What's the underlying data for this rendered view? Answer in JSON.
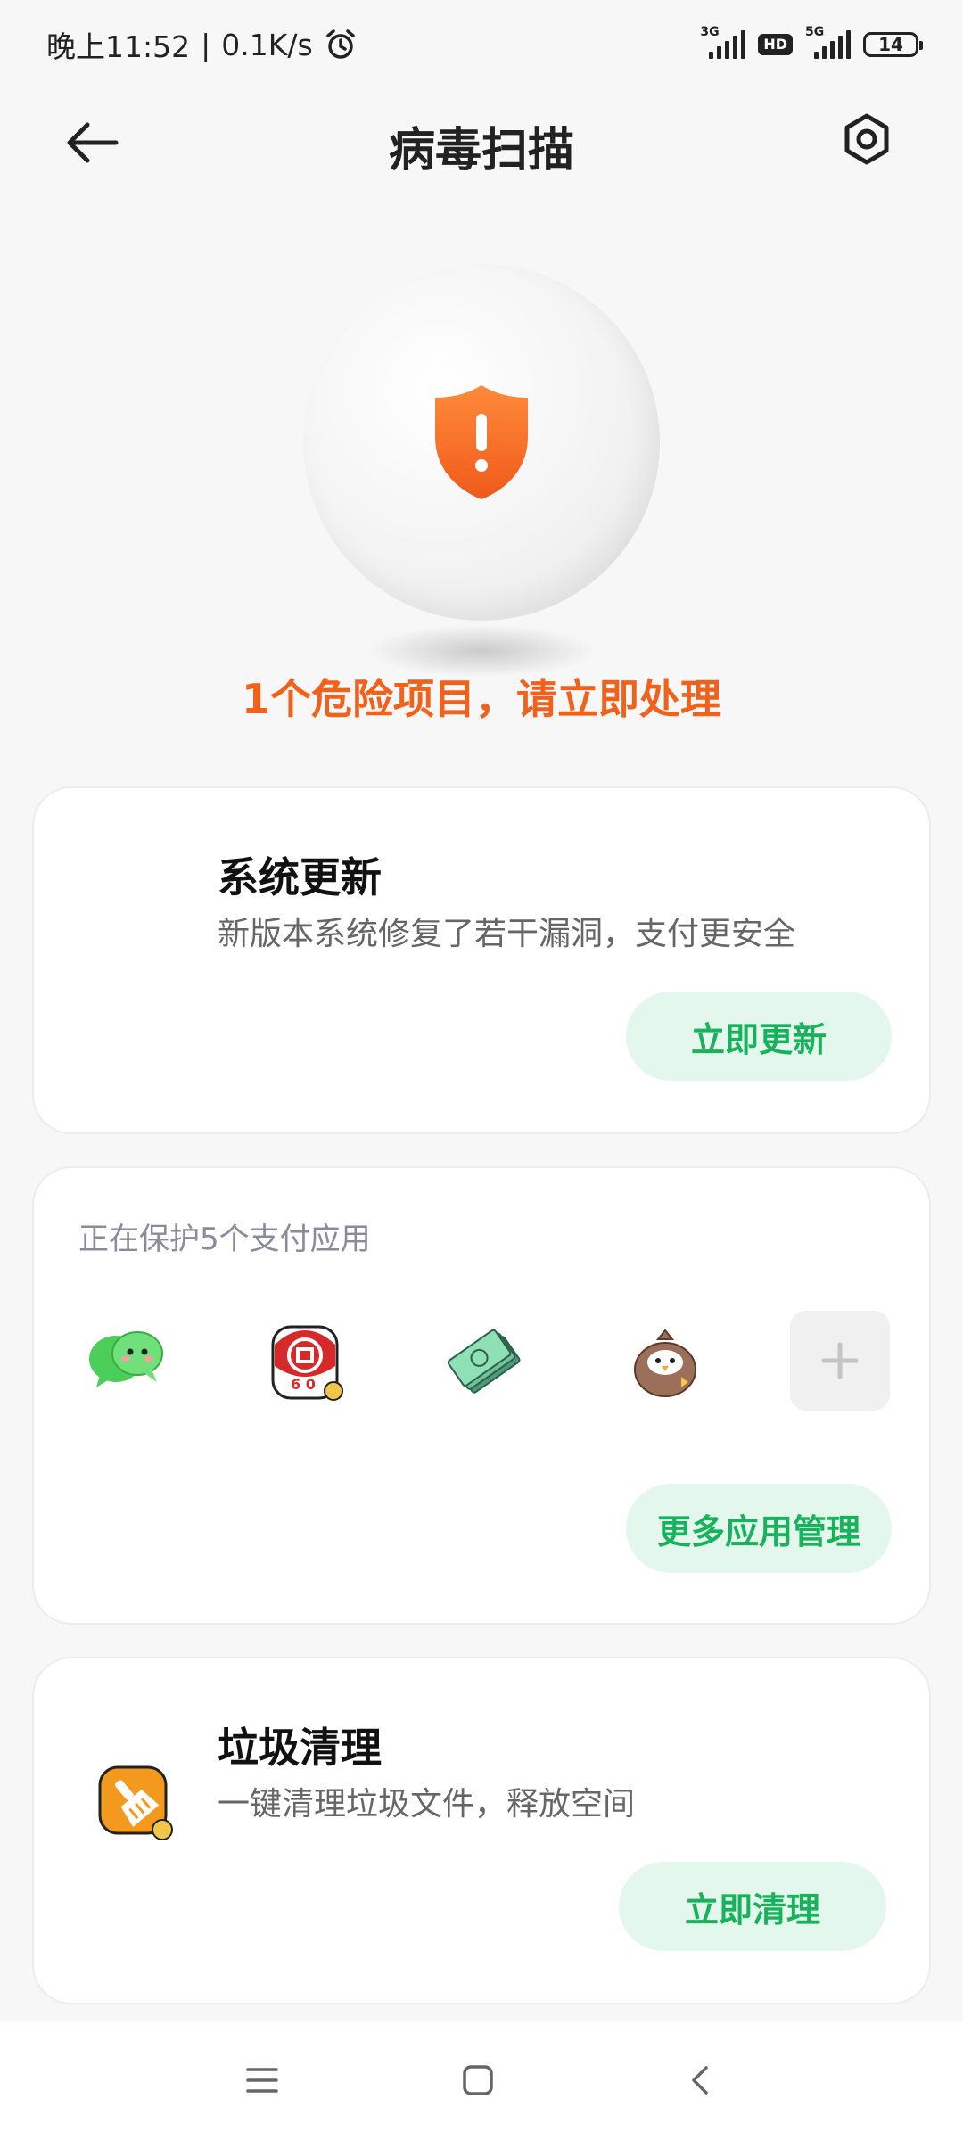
{
  "status_bar": {
    "time": "晚上11:52",
    "separator": "|",
    "network_speed": "0.1K/s",
    "alarm_icon": "alarm-clock-icon",
    "sim1_type": "3G",
    "hd_label": "HD",
    "sim2_type": "5G",
    "battery_level": "14"
  },
  "header": {
    "title": "病毒扫描",
    "back_icon": "arrow-left-icon",
    "settings_icon": "hexagon-gear-icon"
  },
  "hero": {
    "icon": "shield-warning-icon",
    "status_text": "1个危险项目，请立即处理",
    "accent_color": "#f0621b"
  },
  "system_update": {
    "title": "系统更新",
    "description": "新版本系统修复了若干漏洞，支付更安全",
    "button_label": "立即更新"
  },
  "payment_protection": {
    "label": "正在保护5个支付应用",
    "apps": [
      {
        "name": "wechat",
        "icon": "wechat-icon"
      },
      {
        "name": "icbc",
        "icon": "bank-app-icon"
      },
      {
        "name": "cash",
        "icon": "money-stack-icon"
      },
      {
        "name": "bird",
        "icon": "bird-app-icon"
      }
    ],
    "add_icon": "plus-icon",
    "button_label": "更多应用管理"
  },
  "junk_cleanup": {
    "icon": "broom-icon",
    "title": "垃圾清理",
    "description": "一键清理垃圾文件，释放空间",
    "button_label": "立即清理"
  },
  "colors": {
    "primary_green": "#18b25c",
    "button_bg": "#e3f7ec",
    "warning_orange": "#f0621b"
  },
  "nav_bar": {
    "menu_icon": "menu-lines-icon",
    "home_icon": "square-home-icon",
    "back_icon": "chevron-left-icon"
  }
}
